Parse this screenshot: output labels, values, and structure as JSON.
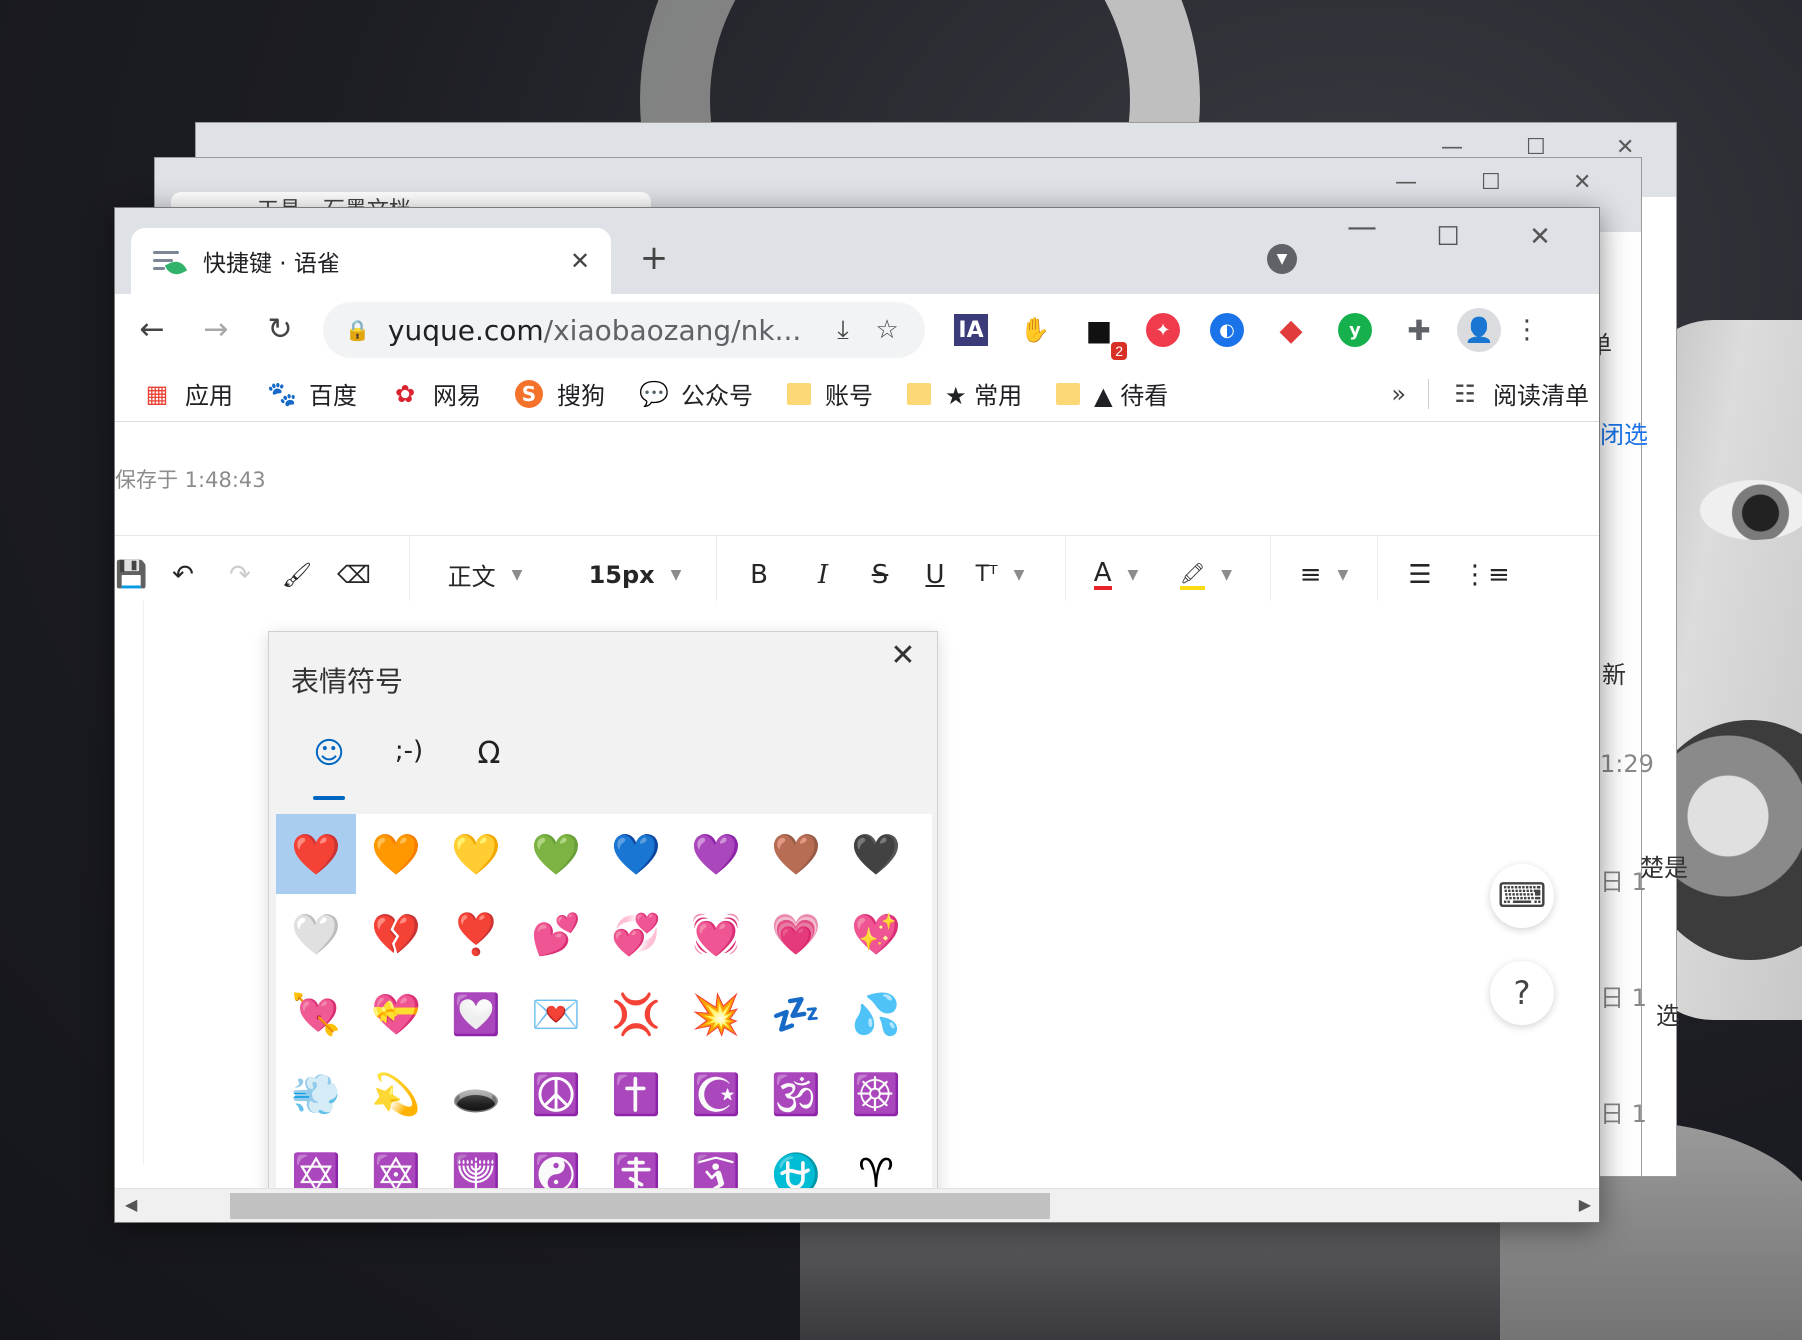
{
  "background_windows": {
    "win2_tab_title": "工具 - 石墨文档",
    "side_texts": [
      "单",
      "闭选",
      "新",
      "1:29",
      "日 1",
      "楚是",
      "日 1",
      "选",
      "日 1"
    ]
  },
  "tab": {
    "title": "快捷键 · 语雀",
    "close_glyph": "✕"
  },
  "tabstrip": {
    "new_tab_glyph": "+",
    "search_glyph": "▼"
  },
  "window_controls": {
    "min": "—",
    "max": "☐",
    "close": "✕"
  },
  "nav": {
    "back": "←",
    "forward": "→",
    "reload": "↻"
  },
  "address": {
    "domain": "yuque.com",
    "path": "/xiaobaozang/nk...",
    "lock_glyph": "🔒",
    "install_glyph": "⤓",
    "star_glyph": "☆"
  },
  "extensions": [
    {
      "name": "ia-extension-icon",
      "glyph": "IA"
    },
    {
      "name": "hand-extension-icon",
      "glyph": "✋"
    },
    {
      "name": "todo-extension-icon",
      "glyph": "■",
      "badge": "2"
    },
    {
      "name": "red-circle-extension-icon",
      "glyph": "✦",
      "color": "#ef3b4b"
    },
    {
      "name": "blue-circle-extension-icon",
      "glyph": "◐",
      "color": "#1a73e8"
    },
    {
      "name": "red-shape-extension-icon",
      "glyph": "◆",
      "color": "#e03c3c"
    },
    {
      "name": "green-circle-extension-icon",
      "glyph": "y",
      "color": "#16b14d"
    },
    {
      "name": "puzzle-extension-icon",
      "glyph": "✚"
    }
  ],
  "profile_glyph": "👤",
  "menu_glyph": "⋮",
  "bookmarks": [
    {
      "label": "应用",
      "icon": "▦",
      "color": "#4285f4"
    },
    {
      "label": "百度",
      "icon": "🐾",
      "color": "#2a5bdc"
    },
    {
      "label": "网易",
      "icon": "✿",
      "color": "#d9232e"
    },
    {
      "label": "搜狗",
      "icon": "S",
      "color": "#f5722b"
    },
    {
      "label": "公众号",
      "icon": "💬",
      "color": "#22b14c"
    },
    {
      "label": "账号",
      "icon": "folder"
    },
    {
      "label": "★ 常用",
      "icon": "folder"
    },
    {
      "label": "▲ 待看",
      "icon": "folder"
    }
  ],
  "bookmark_more": "»",
  "reading_list": {
    "label": "阅读清单",
    "icon": "☷"
  },
  "saved_status": "保存于 1:48:43",
  "editor_toolbar": {
    "save": "💾",
    "undo": "↶",
    "redo": "↷",
    "format_painter": "🖌",
    "eraser": "⌫",
    "style": "正文",
    "font_size": "15px",
    "bold": "B",
    "italic": "I",
    "strike": "S",
    "underline": "U",
    "tt": "Tᵀ",
    "font_color": "A",
    "highlight": "🖍",
    "align": "≡",
    "list": "☰",
    "ordered_list": "⋮≡",
    "caret": "▼"
  },
  "emoji_panel": {
    "title": "表情符号",
    "close": "✕",
    "tabs": [
      "☺",
      ";-)",
      "Ω"
    ],
    "emojis": [
      "❤️",
      "🧡",
      "💛",
      "💚",
      "💙",
      "💜",
      "🤎",
      "🖤",
      "🤍",
      "💔",
      "❣️",
      "💕",
      "💞",
      "💓",
      "💗",
      "💖",
      "💘",
      "💝",
      "💟",
      "💌",
      "💢",
      "💥",
      "💤",
      "💦",
      "💨",
      "💫",
      "🕳️",
      "☮️",
      "✝️",
      "☪️",
      "🕉️",
      "☸️",
      "✡️",
      "🔯",
      "🕎",
      "☯️",
      "☦️",
      "🛐",
      "⛎",
      "♈"
    ]
  },
  "fab": {
    "keyboard": "⌨",
    "help": "?"
  },
  "scroll": {
    "left": "◀",
    "right": "▶"
  }
}
